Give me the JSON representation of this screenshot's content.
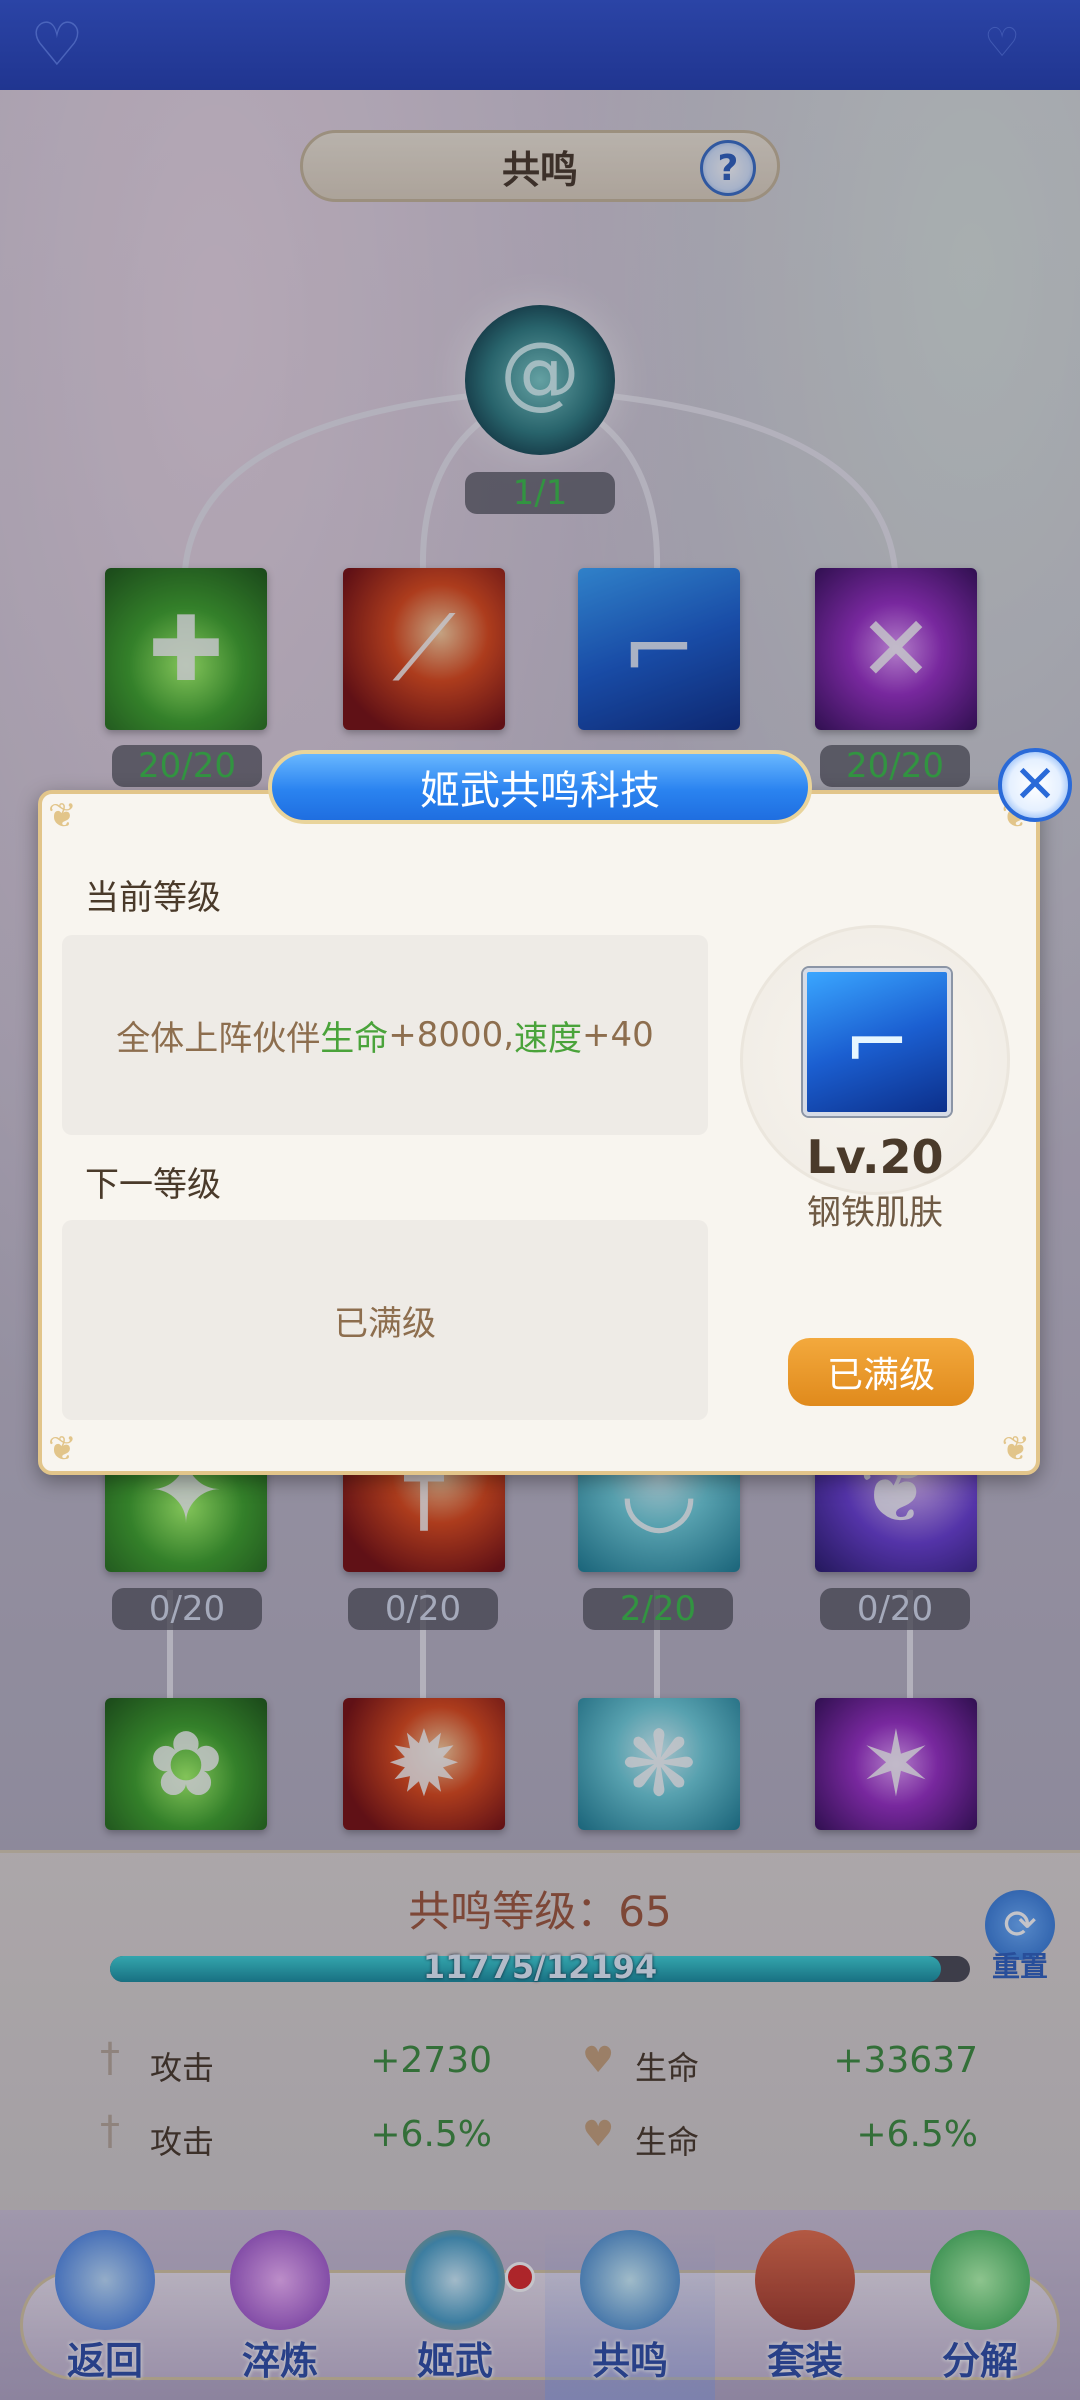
{
  "header": {
    "title": "共鸣"
  },
  "tree": {
    "root_badge": "1/1",
    "row1_badges": [
      "20/20",
      "",
      "",
      "20/20"
    ],
    "row3_badges": [
      "0/20",
      "0/20",
      "2/20",
      "0/20"
    ]
  },
  "modal": {
    "title": "姬武共鸣科技",
    "current_label": "当前等级",
    "current_prefix": "全体上阵伙伴",
    "current_stat1": "生命",
    "current_val1": "+8000,",
    "current_stat2": "速度",
    "current_val2": "+40",
    "next_label": "下一等级",
    "next_text": "已满级",
    "level": "Lv.20",
    "skill_name": "钢铁肌肤",
    "max_button": "已满级"
  },
  "resonance": {
    "level_text": "共鸣等级：65",
    "progress_text": "11775/12194",
    "progress": 0.9657,
    "reset_label": "重置",
    "stats": [
      {
        "label": "攻击",
        "value": "+2730"
      },
      {
        "label": "生命",
        "value": "+33637"
      },
      {
        "label": "攻击",
        "value": "+6.5%"
      },
      {
        "label": "生命",
        "value": "+6.5%"
      }
    ]
  },
  "nav": {
    "items": [
      "返回",
      "淬炼",
      "姬武",
      "共鸣",
      "套装",
      "分解"
    ],
    "active": "共鸣"
  },
  "colors": {
    "accent_blue": "#2a83f0",
    "gold": "#e2c58a",
    "max_orange": "#e08a1c",
    "stat_green": "#3e8e3e"
  }
}
